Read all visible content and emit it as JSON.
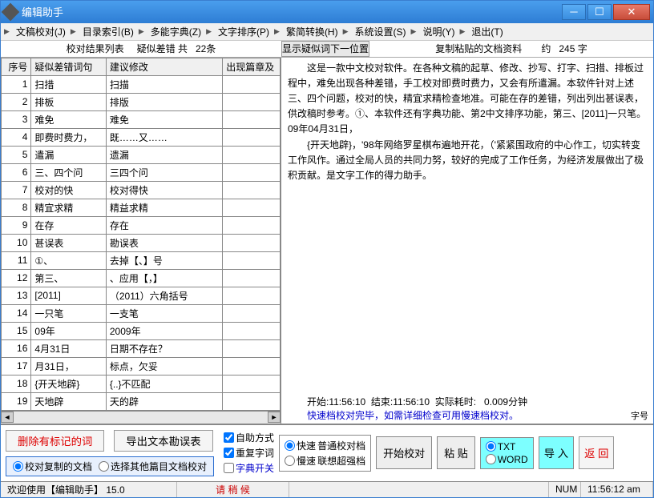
{
  "window": {
    "title": "编辑助手"
  },
  "menu": [
    "文稿校对(J)",
    "目录索引(B)",
    "多能字典(Z)",
    "文字排序(P)",
    "繁简转换(H)",
    "系统设置(S)",
    "说明(Y)",
    "退出(T)"
  ],
  "header": {
    "left_label": "校对结果列表",
    "mid_label": "疑似差错 共",
    "count": "22条",
    "btn_next": "显示疑似词下一位置",
    "right_label": "复制粘贴的文档资料",
    "approx": "约",
    "chars": "245 字"
  },
  "table": {
    "cols": [
      "序号",
      "疑似差错词句",
      "建议修改",
      "出现篇章及"
    ],
    "rows": [
      {
        "n": "1",
        "a": "扫措",
        "b": "扫描"
      },
      {
        "n": "2",
        "a": "排板",
        "b": "排版"
      },
      {
        "n": "3",
        "a": "难免",
        "b": "难免"
      },
      {
        "n": "4",
        "a": "即费时费力，",
        "b": "既……又……"
      },
      {
        "n": "5",
        "a": "遣漏",
        "b": "遗漏"
      },
      {
        "n": "6",
        "a": "三、四个问",
        "b": "三四个问"
      },
      {
        "n": "7",
        "a": "校对的快",
        "b": "校对得快"
      },
      {
        "n": "8",
        "a": "精宜求精",
        "b": "精益求精"
      },
      {
        "n": "9",
        "a": "在存",
        "b": "存在"
      },
      {
        "n": "10",
        "a": "甚误表",
        "b": "勘误表"
      },
      {
        "n": "11",
        "a": "①、",
        "b": "去掉【、】号"
      },
      {
        "n": "12",
        "a": "第三、",
        "b": "、应用【，】"
      },
      {
        "n": "13",
        "a": "[2011]",
        "b": "（2011）六角括号"
      },
      {
        "n": "14",
        "a": "一只笔",
        "b": "一支笔"
      },
      {
        "n": "15",
        "a": "09年",
        "b": "2009年"
      },
      {
        "n": "16",
        "a": "4月31日",
        "b": "日期不存在？"
      },
      {
        "n": "17",
        "a": "月31日，",
        "b": "标点，欠妥"
      },
      {
        "n": "18",
        "a": "{开天地辟}",
        "b": "{..}不匹配"
      },
      {
        "n": "19",
        "a": "天地辟",
        "b": "天的辟"
      }
    ]
  },
  "doc": {
    "p1": "这是一款中文校对软件。在各种文稿的起草、修改、抄写、打字、扫措、排板过程中，难免出现各种差错，手工校对即费时费力，又会有所遣漏。本软件针对上述三、四个问题，校对的快，精宜求精检查地准。可能在存的差错，列出列出甚误表，供改稿时参考。①、本软件还有字典功能、第2中文排序功能，第三、[2011]一只笔。09年04月31日，",
    "p2": "{开天地辟}，'98年网络罗星棋布遍地开花，（'紧紧围政府的中心作工，切实转变工作风作。通过全局人员的共同力努，较好的完成了工作任务，为经济发展做出了极积贡献。是文字工作的得力助手。"
  },
  "timing": {
    "start_l": "开始:",
    "start_v": "11:56:10",
    "end_l": "结束:",
    "end_v": "11:56:10",
    "dur_l": "实际耗时:",
    "dur_v": "0.009分钟",
    "msg": "快速档校对完毕，如需详细检查可用慢速档校对。",
    "font": "字号"
  },
  "controls": {
    "del_marked": "删除有标记的词",
    "export": "导出文本勘误表",
    "radio_copied": "校对复制的文档",
    "radio_other": "选择其他篇目文档校对",
    "chk_self": "自助方式",
    "chk_repeat": "重复字词",
    "link_dict": "字典开关",
    "speed_fast": "快速",
    "mode_normal": "普通校对档",
    "speed_slow": "慢速",
    "mode_super": "联想超强档",
    "start": "开始校对",
    "paste": "粘 贴",
    "fmt_txt": "TXT",
    "fmt_word": "WORD",
    "import": "导 入",
    "return": "返 回"
  },
  "status": {
    "welcome": "欢迎使用【编辑助手】 15.0",
    "ime": "请 稍 候",
    "num": "NUM",
    "time": "11:56:12 am"
  }
}
